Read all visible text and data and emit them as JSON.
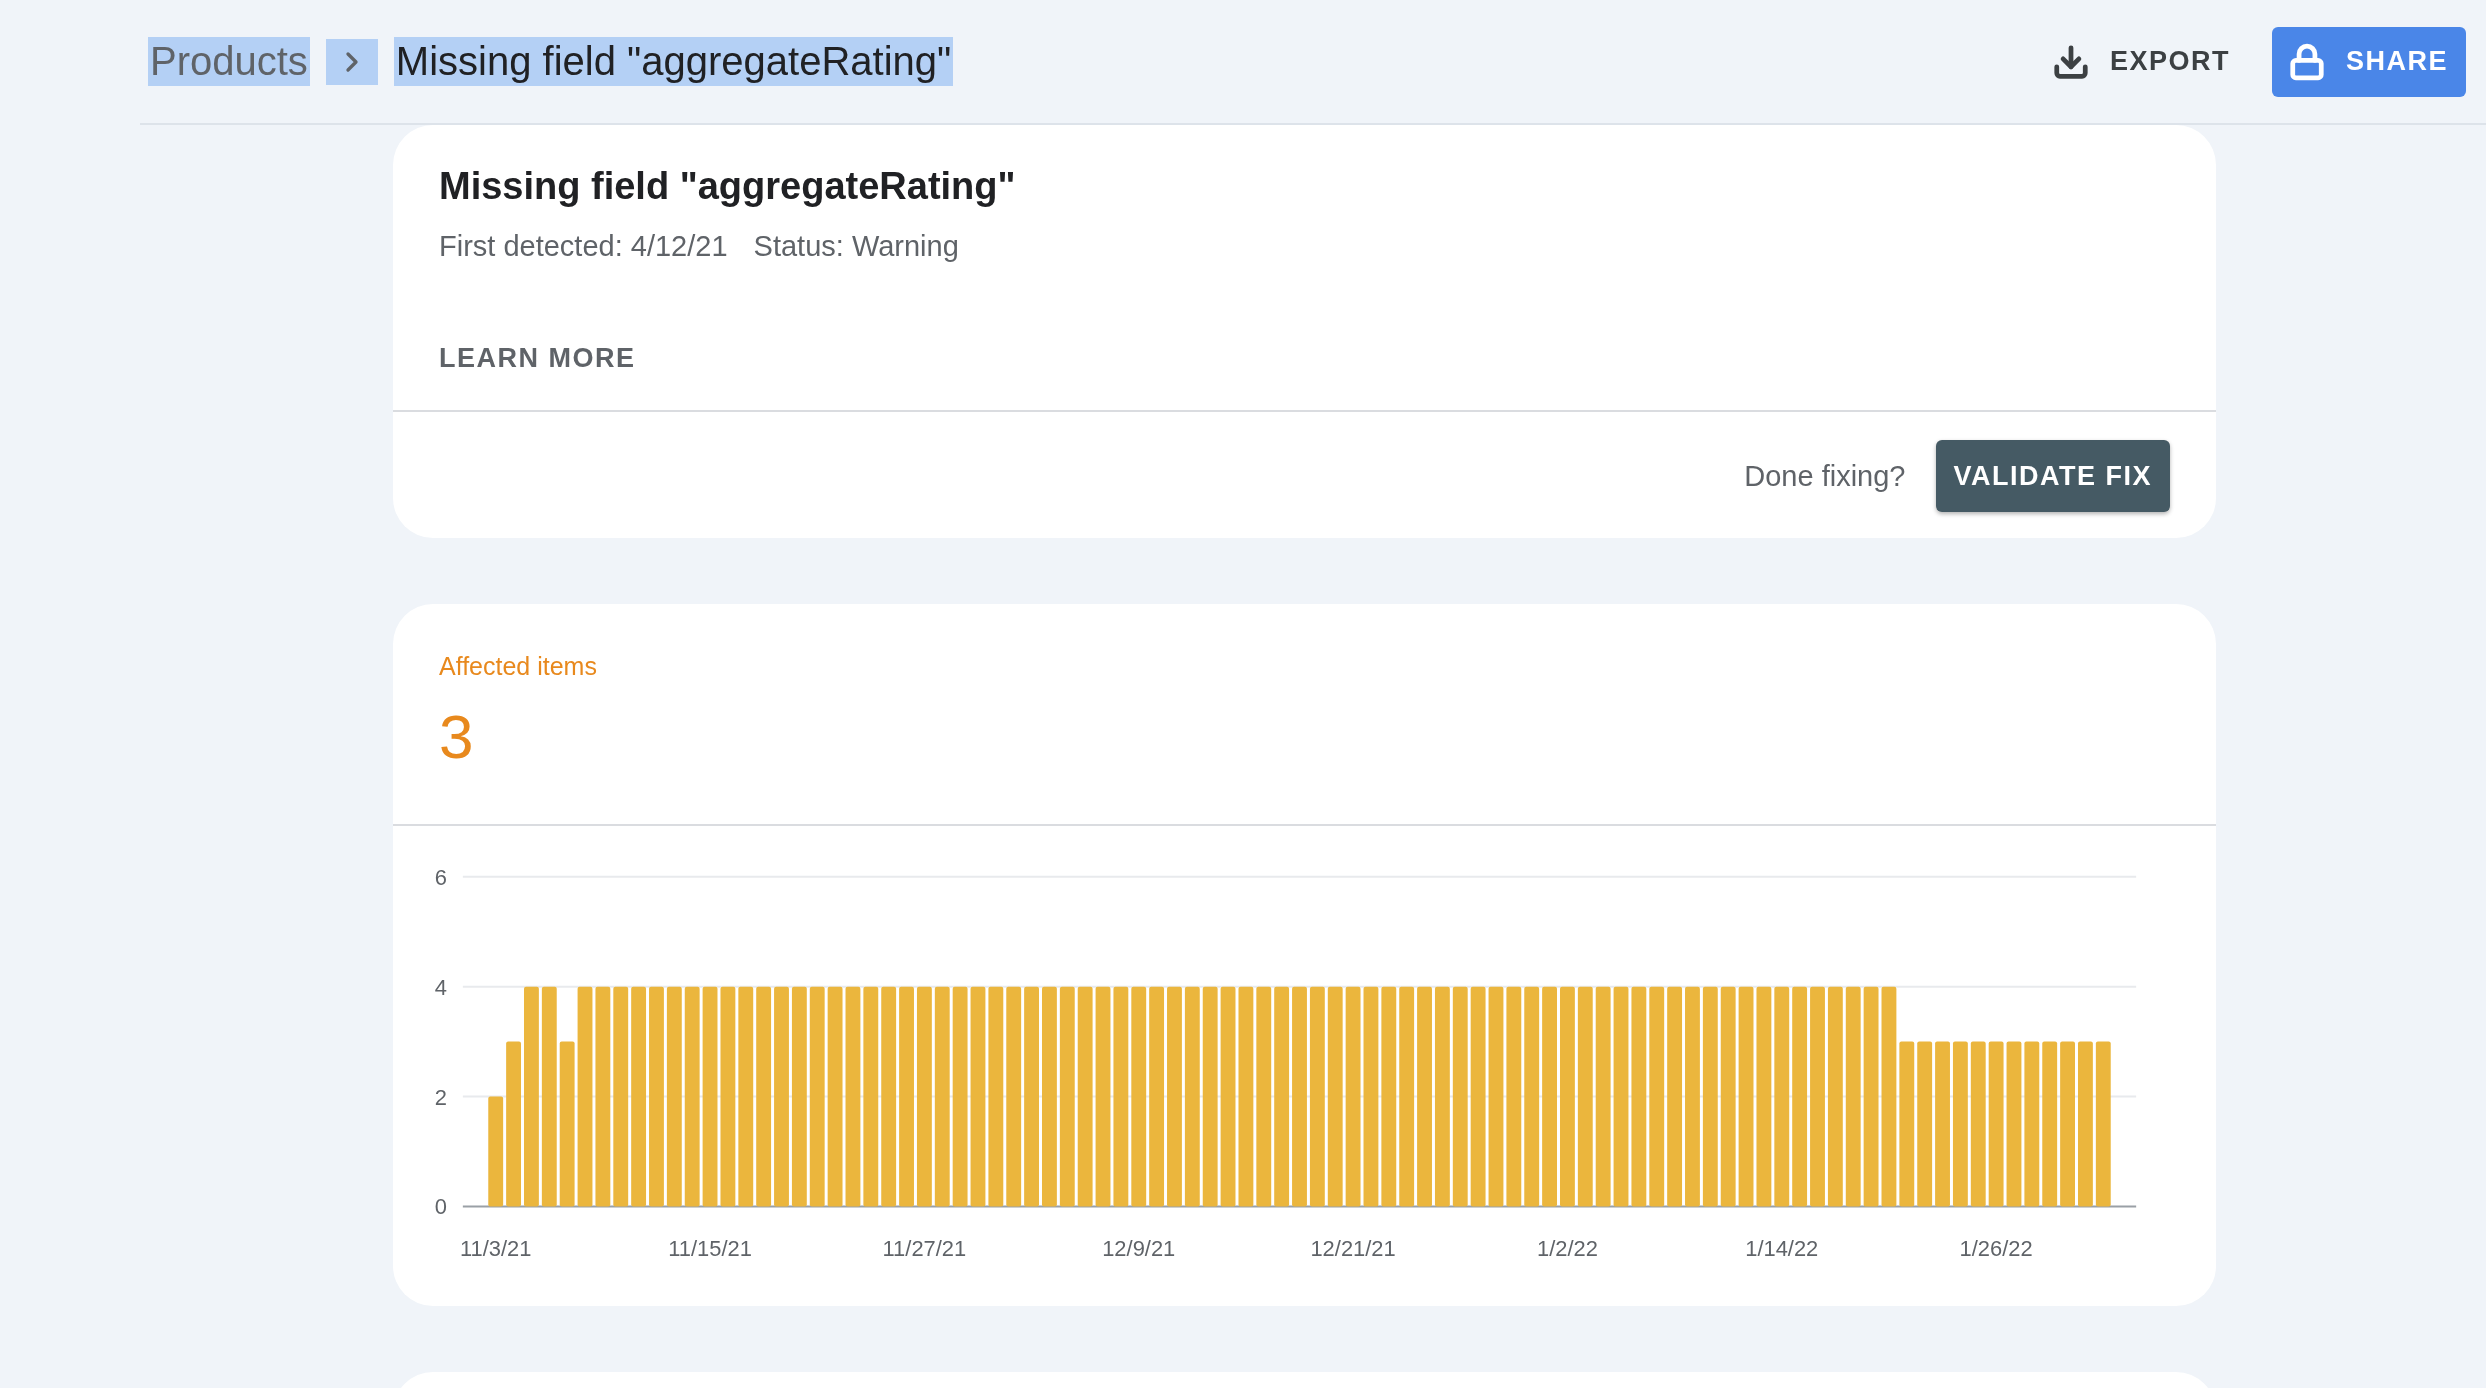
{
  "header": {
    "breadcrumb": [
      {
        "label": "Products",
        "current": false
      },
      {
        "label": "Missing field \"aggregateRating\"",
        "current": true
      }
    ],
    "highlighted": true,
    "actions": [
      {
        "kind": "export",
        "label": "EXPORT"
      },
      {
        "kind": "share",
        "label": "SHARE"
      }
    ]
  },
  "issue": {
    "title": "Missing field \"aggregateRating\"",
    "first_detected": "First detected: 4/12/21",
    "status": "Status: Warning",
    "learn_more": "LEARN MORE",
    "done_prompt": "Done fixing?",
    "validate_button": "VALIDATE FIX"
  },
  "affected": {
    "label": "Affected items",
    "count": "3",
    "chart_data": {
      "type": "bar",
      "categories": [
        "11/3/21",
        null,
        null,
        null,
        null,
        null,
        null,
        null,
        null,
        null,
        null,
        null,
        "11/15/21",
        null,
        null,
        null,
        null,
        null,
        null,
        null,
        null,
        null,
        null,
        null,
        "11/27/21",
        null,
        null,
        null,
        null,
        null,
        null,
        null,
        null,
        null,
        null,
        null,
        "12/9/21",
        null,
        null,
        null,
        null,
        null,
        null,
        null,
        null,
        null,
        null,
        null,
        "12/21/21",
        null,
        null,
        null,
        null,
        null,
        null,
        null,
        null,
        null,
        null,
        null,
        "1/2/22",
        null,
        null,
        null,
        null,
        null,
        null,
        null,
        null,
        null,
        null,
        null,
        "1/14/22",
        null,
        null,
        null,
        null,
        null,
        null,
        null,
        null,
        null,
        null,
        null,
        "1/26/22",
        null,
        null,
        null,
        null,
        null,
        null
      ],
      "series": [
        {
          "color": "#ebb63d",
          "values": [
            2,
            3,
            4,
            4,
            3,
            4,
            4,
            4,
            4,
            4,
            4,
            4,
            4,
            4,
            4,
            4,
            4,
            4,
            4,
            4,
            4,
            4,
            4,
            4,
            4,
            4,
            4,
            4,
            4,
            4,
            4,
            4,
            4,
            4,
            4,
            4,
            4,
            4,
            4,
            4,
            4,
            4,
            4,
            4,
            4,
            4,
            4,
            4,
            4,
            4,
            4,
            4,
            4,
            4,
            4,
            4,
            4,
            4,
            4,
            4,
            4,
            4,
            4,
            4,
            4,
            4,
            4,
            4,
            4,
            4,
            4,
            4,
            4,
            4,
            4,
            4,
            4,
            4,
            4,
            3,
            3,
            3,
            3,
            3,
            3,
            3,
            3,
            3,
            3,
            3,
            3
          ]
        }
      ],
      "ylim": [
        0,
        6
      ],
      "yticks": [
        0,
        2,
        4,
        6
      ]
    }
  }
}
